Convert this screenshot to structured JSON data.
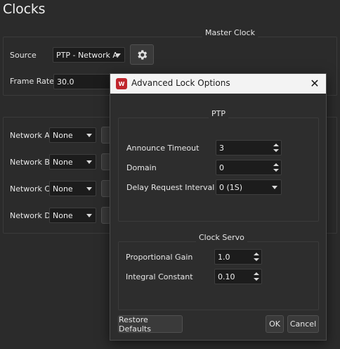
{
  "page": {
    "title": "Clocks"
  },
  "master_clock": {
    "title": "Master Clock",
    "source_label": "Source",
    "source_value": "PTP - Network A",
    "frame_rate_label": "Frame Rate",
    "frame_rate_value": "30.0",
    "settings_icon": "gear-icon"
  },
  "networks": [
    {
      "label": "Network A",
      "value": "None"
    },
    {
      "label": "Network B",
      "value": "None"
    },
    {
      "label": "Network C",
      "value": "None"
    },
    {
      "label": "Network D",
      "value": "None"
    }
  ],
  "dialog": {
    "title": "Advanced Lock Options",
    "app_icon": "W",
    "ptp": {
      "title": "PTP",
      "announce_timeout_label": "Announce Timeout",
      "announce_timeout_value": "3",
      "domain_label": "Domain",
      "domain_value": "0",
      "delay_request_interval_label": "Delay Request Interval",
      "delay_request_interval_value": "0 (1S)"
    },
    "clock_servo": {
      "title": "Clock Servo",
      "proportional_gain_label": "Proportional Gain",
      "proportional_gain_value": "1.0",
      "integral_constant_label": "Integral Constant",
      "integral_constant_value": "0.10"
    },
    "buttons": {
      "restore_defaults": "Restore Defaults",
      "ok": "OK",
      "cancel": "Cancel"
    }
  }
}
